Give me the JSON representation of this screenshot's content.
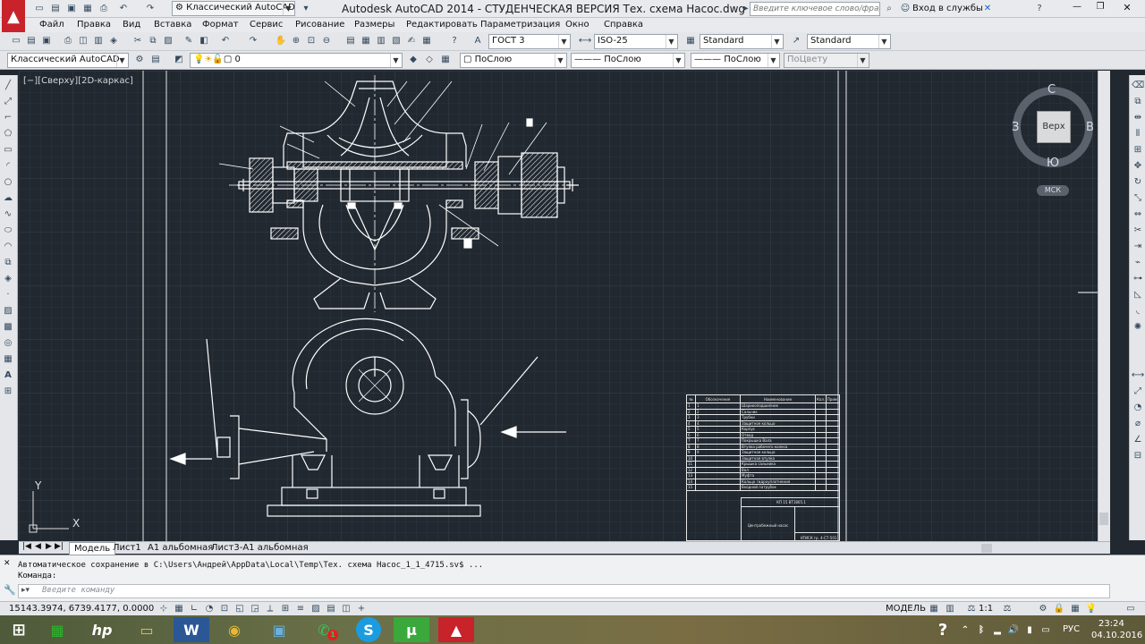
{
  "title": {
    "workspace": "Классический AutoCAD",
    "window_title": "Autodesk AutoCAD 2014 - СТУДЕНЧЕСКАЯ ВЕРСИЯ    Тех. схема Насос.dwg",
    "search_placeholder": "Введите ключевое слово/фразу",
    "signin": "Вход в службы"
  },
  "menu": [
    "Файл",
    "Правка",
    "Вид",
    "Вставка",
    "Формат",
    "Сервис",
    "Рисование",
    "Размеры",
    "Редактировать",
    "Параметризация",
    "Окно",
    "Справка"
  ],
  "toolbar1": {
    "text_style": "ГОСТ 3",
    "dim_style": "ISO-25",
    "table_style": "Standard",
    "multileader_style": "Standard"
  },
  "toolbar2": {
    "workspace": "Классический AutoCAD",
    "layer": "0",
    "color": "ПоСлою",
    "linetype": "ПоСлою",
    "lineweight": "ПоСлою",
    "plotstyle": "ПоЦвету"
  },
  "viewport": {
    "label": "[−][Сверху][2D-каркас]",
    "viewcube_top": "Верх",
    "compass": {
      "n": "С",
      "s": "Ю",
      "e": "В",
      "w": "З"
    },
    "ucs_badge": "МСК",
    "ucs_x": "X",
    "ucs_y": "Y"
  },
  "title_block": {
    "headers": [
      "№",
      "Обозначение",
      "Наименование",
      "Кол.",
      "Прим."
    ],
    "rows": [
      [
        "1",
        "1",
        "Шарикоподшипник"
      ],
      [
        "2",
        "2",
        "Сальник"
      ],
      [
        "3",
        "3",
        "Трубки"
      ],
      [
        "4",
        "4",
        "Защитное кольцо"
      ],
      [
        "5",
        "5",
        "Корпус"
      ],
      [
        "6",
        "6",
        "Отвод"
      ],
      [
        "7",
        "7",
        "Покрышка Вала"
      ],
      [
        "8",
        "8",
        "Втулка рабочего колеса"
      ],
      [
        "9",
        "9",
        "Защитное кольцо"
      ],
      [
        "10",
        "",
        "Защитная втулка"
      ],
      [
        "11",
        "",
        "Крышка сальника"
      ],
      [
        "12",
        "",
        "Вал"
      ],
      [
        "13",
        "",
        "Муфта"
      ],
      [
        "14",
        "",
        "Кольцо гидроуплотнения"
      ],
      [
        "15",
        "",
        "Входной патрубок"
      ],
      [
        "16",
        "",
        "Выходной патрубок"
      ]
    ],
    "designation": "КП 15 ВТ1805.1",
    "name": "Центробежный насос",
    "org": "НТИСК гр. 4-СТ-501"
  },
  "tabs": [
    "Модель",
    "Лист1",
    "А1 альбомная",
    "Лист3-А1 альбомная"
  ],
  "command": {
    "history": "Автоматическое сохранение в C:\\Users\\Андрей\\AppData\\Local\\Temp\\Тех. схема Насос_1_1_4715.sv$ ...",
    "prompt": "Команда:",
    "placeholder": "Введите команду"
  },
  "status": {
    "coords": "15143.3974, 6739.4177, 0.0000",
    "model": "МОДЕЛЬ",
    "scale": "1:1"
  },
  "taskbar": {
    "lang": "РУС",
    "time": "23:24",
    "date": "04.10.2016",
    "whatsapp_badge": "1"
  }
}
